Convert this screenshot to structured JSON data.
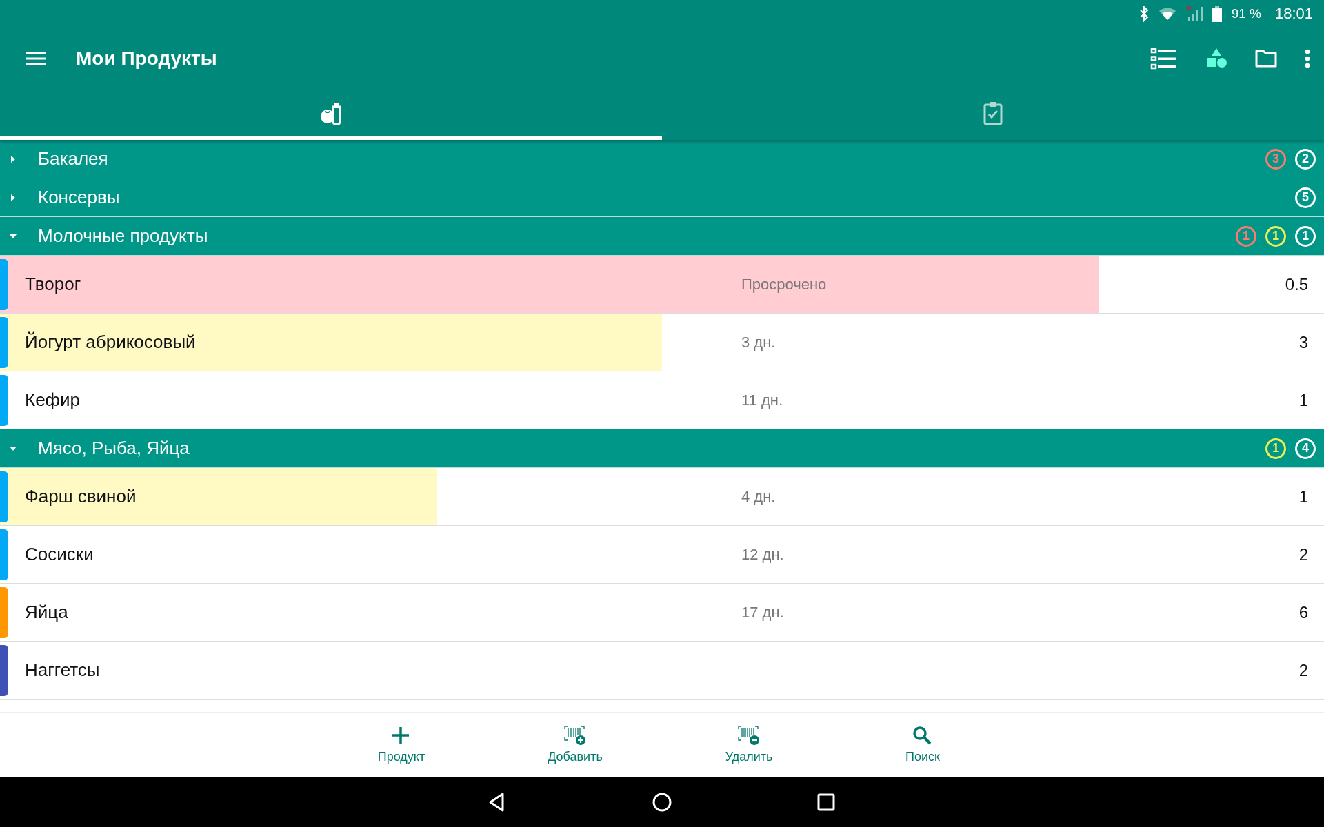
{
  "status_bar": {
    "battery": "91 %",
    "time": "18:01"
  },
  "app_bar": {
    "title": "Мои Продукты",
    "actions": [
      {
        "kind": "list"
      },
      {
        "kind": "shapes"
      },
      {
        "kind": "folder"
      },
      {
        "kind": "more"
      }
    ]
  },
  "tabs": [
    {
      "kind": "products",
      "selected": true
    },
    {
      "kind": "checklist",
      "selected": false
    }
  ],
  "groups": [
    {
      "name": "Бакалея",
      "expanded": false,
      "badges": [
        {
          "count": "3",
          "color": "#ff7a6e"
        },
        {
          "count": "2",
          "color": "#ffffff"
        }
      ]
    },
    {
      "name": "Консервы",
      "expanded": false,
      "badges": [
        {
          "count": "5",
          "color": "#ffffff"
        }
      ]
    },
    {
      "name": "Молочные продукты",
      "expanded": true,
      "badges": [
        {
          "count": "1",
          "color": "#ff7a6e"
        },
        {
          "count": "1",
          "color": "#eeee55"
        },
        {
          "count": "1",
          "color": "#ffffff"
        }
      ],
      "items": [
        {
          "name": "Творог",
          "expiry": "Просрочено",
          "quantity": "0.5",
          "color": "#03a9f4",
          "highlight": {
            "expired": true,
            "level": 0.83
          }
        },
        {
          "name": "Йогурт абрикосовый",
          "expiry": "3 дн.",
          "quantity": "3",
          "color": "#03a9f4",
          "highlight": {
            "expired": false,
            "level": 0.5
          }
        },
        {
          "name": "Кефир",
          "expiry": "11 дн.",
          "quantity": "1",
          "color": "#03a9f4"
        }
      ]
    },
    {
      "name": "Мясо, Рыба, Яйца",
      "expanded": true,
      "badges": [
        {
          "count": "1",
          "color": "#eeee55"
        },
        {
          "count": "4",
          "color": "#ffffff"
        }
      ],
      "items": [
        {
          "name": "Фарш свиной",
          "expiry": "4 дн.",
          "quantity": "1",
          "color": "#03a9f4",
          "highlight": {
            "expired": false,
            "level": 0.33
          }
        },
        {
          "name": "Сосиски",
          "expiry": "12 дн.",
          "quantity": "2",
          "color": "#03a9f4"
        },
        {
          "name": "Яйца",
          "expiry": "17 дн.",
          "quantity": "6",
          "color": "#ff9800"
        },
        {
          "name": "Наггетсы",
          "quantity": "2",
          "color": "#3f51b5"
        }
      ]
    }
  ],
  "bottom_actions": [
    {
      "kind": "add",
      "label": "Продукт"
    },
    {
      "kind": "barcode-add",
      "label": "Добавить"
    },
    {
      "kind": "barcode-remove",
      "label": "Удалить"
    },
    {
      "kind": "search",
      "label": "Поиск"
    }
  ]
}
